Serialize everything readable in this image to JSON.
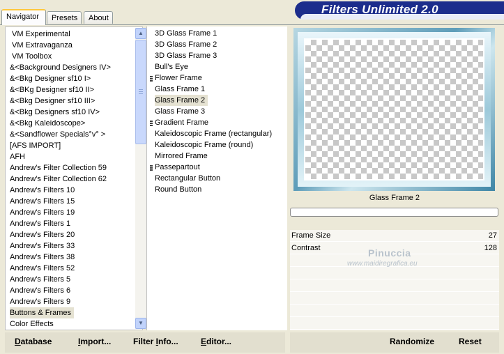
{
  "tabs": [
    "Navigator",
    "Presets",
    "About"
  ],
  "banner_title": "Filters Unlimited 2.0",
  "categories": [
    "VM Experimental",
    "VM Extravaganza",
    "VM Toolbox",
    "&<Background Designers IV>",
    "&<Bkg Designer sf10 I>",
    "&<BKg Designer sf10 II>",
    "&<Bkg Designer sf10 III>",
    "&<Bkg Designers sf10 IV>",
    "&<Bkg Kaleidoscope>",
    "&<Sandflower Specials°v° >",
    "[AFS IMPORT]",
    "AFH",
    "Andrew's Filter Collection 59",
    "Andrew's Filter Collection 62",
    "Andrew's Filters 10",
    "Andrew's Filters 15",
    "Andrew's Filters 19",
    "Andrew's Filters 1",
    "Andrew's Filters 20",
    "Andrew's Filters 33",
    "Andrew's Filters 38",
    "Andrew's Filters 52",
    "Andrew's Filters 5",
    "Andrew's Filters 6",
    "Andrew's Filters 9",
    "Buttons & Frames",
    "Color Effects"
  ],
  "selected_category": "Buttons & Frames",
  "filters": [
    {
      "label": "3D Glass Frame 1",
      "marker": false
    },
    {
      "label": "3D Glass Frame 2",
      "marker": false
    },
    {
      "label": "3D Glass Frame 3",
      "marker": false
    },
    {
      "label": "Bull's Eye",
      "marker": false
    },
    {
      "label": "Flower Frame",
      "marker": true
    },
    {
      "label": "Glass Frame 1",
      "marker": false
    },
    {
      "label": "Glass Frame 2",
      "marker": false
    },
    {
      "label": "Glass Frame 3",
      "marker": false
    },
    {
      "label": "Gradient Frame",
      "marker": true
    },
    {
      "label": "Kaleidoscopic Frame (rectangular)",
      "marker": false
    },
    {
      "label": "Kaleidoscopic Frame (round)",
      "marker": false
    },
    {
      "label": "Mirrored Frame",
      "marker": false
    },
    {
      "label": "Passepartout",
      "marker": true
    },
    {
      "label": "Rectangular Button",
      "marker": false
    },
    {
      "label": "Round Button",
      "marker": false
    }
  ],
  "selected_filter": "Glass Frame 2",
  "preview_name": "Glass Frame 2",
  "params": [
    {
      "label": "Frame Size",
      "value": "27"
    },
    {
      "label": "Contrast",
      "value": "128"
    }
  ],
  "watermark": {
    "name": "Pinuccia",
    "site": "www.maidiregrafica.eu"
  },
  "buttons": {
    "database": {
      "u": "D",
      "rest": "atabase"
    },
    "import": {
      "u": "I",
      "rest": "mport..."
    },
    "filter_info_a": "Filter ",
    "filter_info_u": "I",
    "filter_info_b": "nfo...",
    "editor": {
      "u": "E",
      "rest": "ditor..."
    },
    "randomize": "Randomize",
    "reset": "Reset"
  },
  "colors": {
    "banner": "#1c2d8c",
    "selection": "#e5e2d2",
    "tab_highlight": "#ffc83c"
  }
}
